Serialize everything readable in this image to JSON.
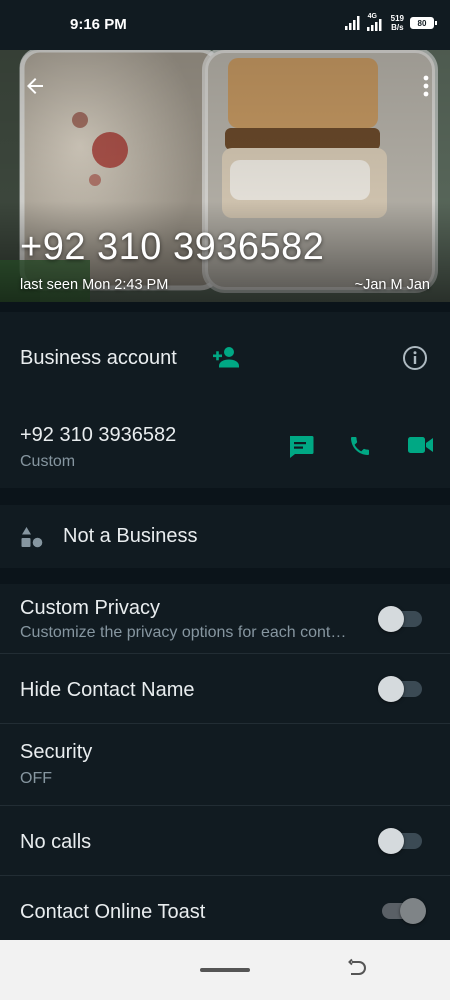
{
  "status_bar": {
    "time": "9:16 PM",
    "net_speed_value": "519",
    "net_speed_unit": "B/s",
    "network_type": "4G",
    "battery": "80"
  },
  "header": {
    "phone": "+92 310 3936582",
    "last_seen": "last seen Mon 2:43 PM",
    "push_name": "~Jan M Jan"
  },
  "business": {
    "label": "Business account"
  },
  "phone_row": {
    "number": "+92 310 3936582",
    "type": "Custom"
  },
  "not_business": {
    "label": "Not a Business"
  },
  "settings": [
    {
      "title": "Custom Privacy",
      "subtitle": "Customize the privacy options for each cont…",
      "toggle": "off"
    },
    {
      "title": "Hide Contact Name",
      "toggle": "off"
    },
    {
      "title": "Security",
      "subtitle": "OFF"
    },
    {
      "title": "No calls",
      "toggle": "off"
    },
    {
      "title": "Contact Online Toast",
      "toggle": "on"
    }
  ],
  "colors": {
    "accent": "#00a884",
    "background": "#111b21",
    "separator": "#0b141a"
  },
  "icons": [
    "back-arrow-icon",
    "more-vert-icon",
    "add-contact-icon",
    "info-icon",
    "message-icon",
    "phone-icon",
    "video-icon",
    "shapes-icon"
  ]
}
